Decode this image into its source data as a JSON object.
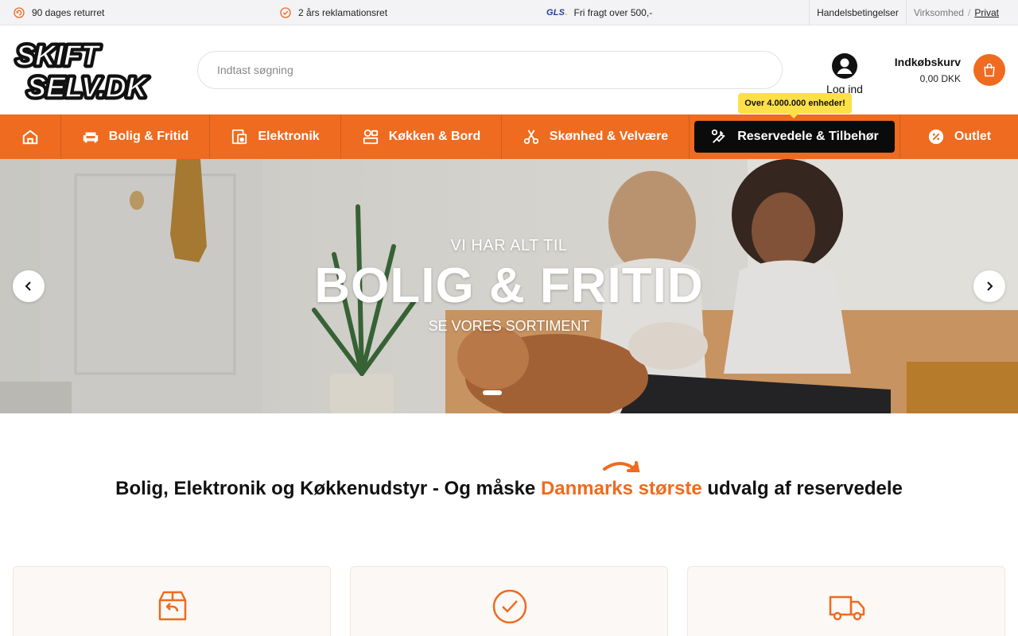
{
  "topbar": {
    "returns": "90 dages returret",
    "warranty": "2 års reklamationsret",
    "gls_logo": "GLS",
    "shipping": "Fri fragt over 500,-",
    "terms": "Handelsbetingelser",
    "business": "Virksomhed",
    "separator": "/",
    "private": "Privat"
  },
  "header": {
    "logo_text": [
      "SKIFT",
      "SELV.DK"
    ],
    "search_placeholder": "Indtast søgning",
    "login_label": "Log ind",
    "cart_title": "Indkøbskurv",
    "cart_total": "0,00 DKK"
  },
  "nav": {
    "items": [
      {
        "label": "Bolig & Fritid",
        "icon": "sofa-icon"
      },
      {
        "label": "Elektronik",
        "icon": "devices-icon"
      },
      {
        "label": "Køkken & Bord",
        "icon": "kitchen-icon"
      },
      {
        "label": "Skønhed & Velvære",
        "icon": "scissors-icon"
      },
      {
        "label": "Reservedele & Tilbehør",
        "icon": "wrench-icon"
      },
      {
        "label": "Outlet",
        "icon": "discount-icon"
      }
    ],
    "badge": "Over 4.000.000 enheder!"
  },
  "hero": {
    "subtitle": "VI HAR ALT TIL",
    "title": "BOLIG & FRITID",
    "cta": "SE VORES SORTIMENT"
  },
  "tagline": {
    "before": "Bolig, Elektronik og Køkkenudstyr - Og måske",
    "highlight": "Danmarks største",
    "after": "udvalg af reservedele"
  },
  "colors": {
    "brand": "#ee6b1f",
    "badge": "#fde047"
  }
}
